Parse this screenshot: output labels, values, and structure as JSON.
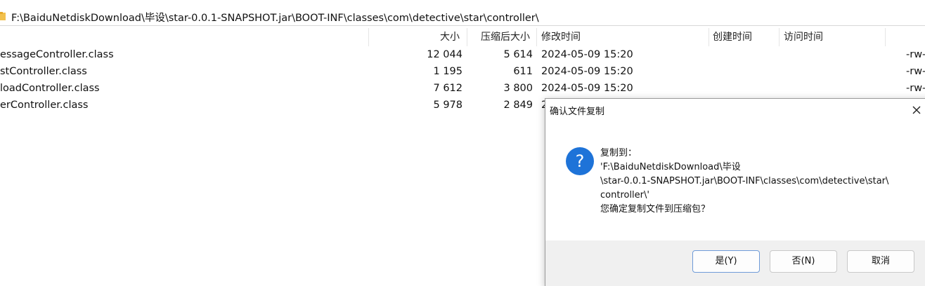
{
  "path_bar": {
    "path": "F:\\BaiduNetdiskDownload\\毕设\\star-0.0.1-SNAPSHOT.jar\\BOOT-INF\\classes\\com\\detective\\star\\controller\\"
  },
  "columns": {
    "size": "大小",
    "packed_size": "压缩后大小",
    "modified": "修改时间",
    "created": "创建时间",
    "accessed": "访问时间"
  },
  "files": [
    {
      "name": "essageController.class",
      "size": "12 044",
      "packed": "5 614",
      "modified": "2024-05-09 15:20",
      "attr": "-rw-"
    },
    {
      "name": "stController.class",
      "size": "1 195",
      "packed": "611",
      "modified": "2024-05-09 15:20",
      "attr": "-rw-"
    },
    {
      "name": "loadController.class",
      "size": "7 612",
      "packed": "3 800",
      "modified": "2024-05-09 15:20",
      "attr": "-rw-"
    },
    {
      "name": "erController.class",
      "size": "5 978",
      "packed": "2 849",
      "modified": "2",
      "attr": ""
    }
  ],
  "dialog": {
    "title": "确认文件复制",
    "message_lines": [
      "复制到：",
      "'F:\\BaiduNetdiskDownload\\毕设",
      "\\star-0.0.1-SNAPSHOT.jar\\BOOT-INF\\classes\\com\\detective\\star\\",
      "controller\\'",
      "您确定复制文件到压缩包？"
    ],
    "buttons": {
      "yes": "是(Y)",
      "no": "否(N)",
      "cancel": "取消"
    }
  },
  "icons": {
    "folder": "folder-icon",
    "question": "question-icon",
    "close": "close-icon"
  },
  "colors": {
    "question_icon": "#1e73d8",
    "dialog_footer": "#f0f0f0",
    "primary_button_border": "#6f9bd8"
  }
}
